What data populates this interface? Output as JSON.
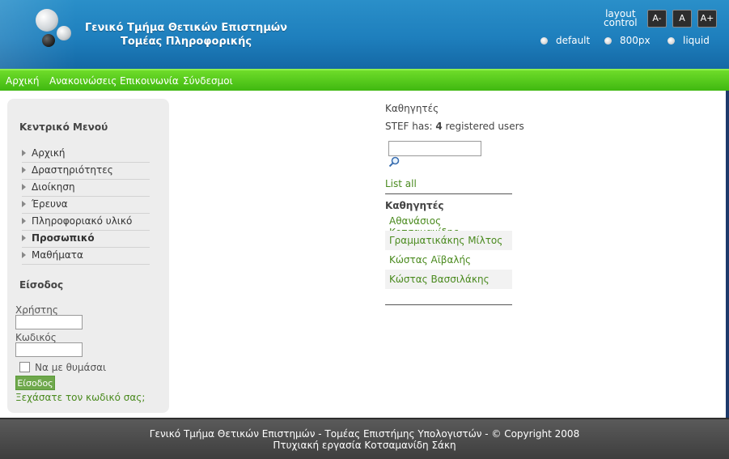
{
  "header": {
    "title_line1": "Γενικό Τμήμα Θετικών Επιστημών",
    "title_line2": "Τομέας Πληροφορικής",
    "layout_control_line1": "layout",
    "layout_control_line2": "control",
    "font_buttons": [
      "A-",
      "A",
      "A+"
    ],
    "layout_options": [
      "default",
      "800px",
      "liquid"
    ]
  },
  "topnav": {
    "items": [
      "Αρχική",
      "Ανακοινώσεις",
      "Επικοινωνία",
      "Σύνδεσμοι"
    ]
  },
  "sidebar": {
    "menu_title": "Κεντρικό Μενού",
    "menu_items": [
      "Αρχική",
      "Δραστηριότητες",
      "Διοίκηση",
      "Έρευνα",
      "Πληροφοριακό υλικό",
      "Προσωπικό",
      "Μαθήματα"
    ],
    "login_title": "Είσοδος",
    "username_label": "Χρήστης",
    "password_label": "Κωδικός",
    "remember_label": "Να με θυμάσαι",
    "login_button": "Είσοδος",
    "forgot_link": "Ξεχάσατε τον κωδικό σας;"
  },
  "main": {
    "category": "Καθηγητές",
    "users_prefix": "STEF has: ",
    "users_count": "4",
    "users_suffix": " registered users",
    "list_all": "List all",
    "group_heading": "Καθηγητές",
    "professors": [
      "Αθανάσιος Κοτσαμανίδης",
      "Γραμματικάκης Μίλτος",
      "Κώστας Αϊβαλής",
      "Κώστας Βασσιλάκης"
    ]
  },
  "footer": {
    "line1": "Γενικό Τμήμα Θετικών Επιστημών - Τομέας Επιστήμης Υπολογιστών - © Copyright 2008",
    "line2": "Πτυχιακή εργασία Κοτσαμανίδη Σάκη"
  },
  "colors": {
    "header_blue": "#1e7fbd",
    "nav_green": "#3fb811",
    "link_green": "#4a8a1e",
    "footer_gray": "#4a4a4a"
  }
}
